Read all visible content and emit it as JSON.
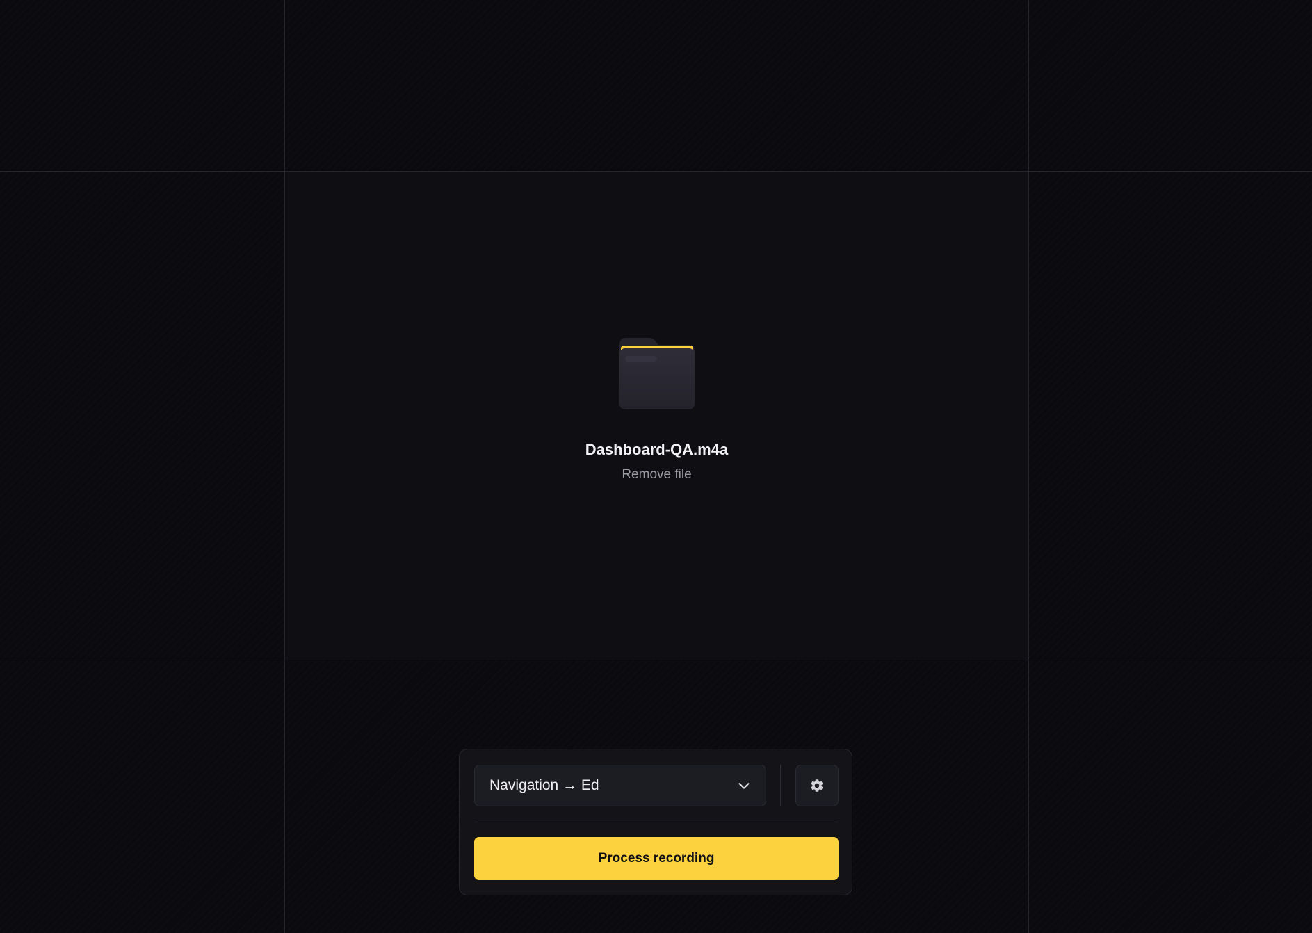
{
  "file": {
    "name": "Dashboard-QA.m4a",
    "remove_label": "Remove file",
    "icon": "folder-icon"
  },
  "controls": {
    "select_value": "Navigation → Ed",
    "select_icon": "chevron-down-icon",
    "settings_icon": "gear-icon",
    "process_label": "Process recording"
  },
  "colors": {
    "background": "#0b0b0f",
    "drop_zone": "#0f0f13",
    "accent": "#fcd33f",
    "panel": "#131318",
    "text_primary": "#f2f2f4",
    "text_secondary": "#9a9aa3"
  }
}
